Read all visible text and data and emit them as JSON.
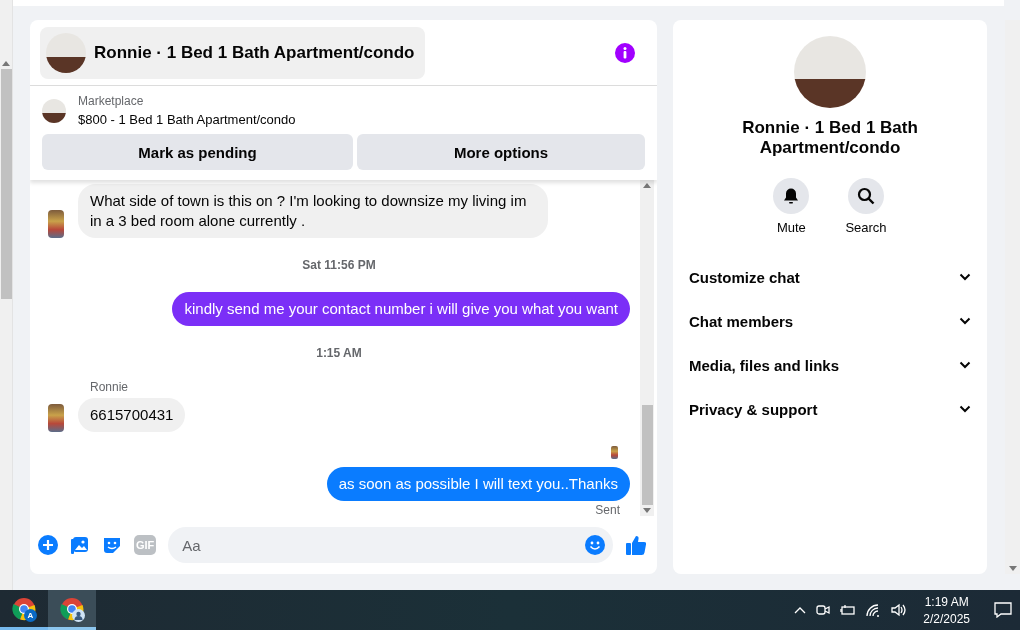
{
  "chat": {
    "title": "Ronnie · 1 Bed 1 Bath Apartment/condo",
    "listing": {
      "label": "Marketplace",
      "title": "$800 - 1 Bed 1 Bath Apartment/condo"
    },
    "actions": [
      "Mark as pending",
      "More options"
    ],
    "messages": [
      {
        "kind": "incoming",
        "text": "What side of town is this on ? I'm looking to downsize my living im in a 3 bed room alone currently ."
      },
      {
        "kind": "timestamp",
        "text": "Sat 11:56 PM"
      },
      {
        "kind": "outgoing",
        "text": "kindly send me your contact number i will give you what you want",
        "color": "#7b2ff7",
        "seen": false
      },
      {
        "kind": "timestamp",
        "text": "1:15 AM"
      },
      {
        "kind": "incoming",
        "sender": "Ronnie",
        "text": "6615700431"
      },
      {
        "kind": "outgoing",
        "text": "as soon as possible I will text you..Thanks",
        "color": "#0a7cff",
        "seen": true,
        "status": "Sent"
      }
    ],
    "composer": {
      "placeholder": "Aa",
      "gif_label": "GIF"
    }
  },
  "details": {
    "title": "Ronnie · 1 Bed 1 Bath Apartment/condo",
    "quick_actions": [
      {
        "kind": "mute",
        "label": "Mute"
      },
      {
        "kind": "search",
        "label": "Search"
      }
    ],
    "sections": [
      {
        "label": "Customize chat",
        "expanded": false
      },
      {
        "label": "Chat members",
        "expanded": false
      },
      {
        "label": "Media, files and links",
        "expanded": false
      },
      {
        "label": "Privacy & support",
        "expanded": false
      }
    ]
  },
  "taskbar": {
    "apps": [
      {
        "kind": "letter",
        "badge": "A",
        "selected": false
      },
      {
        "kind": "person",
        "selected": true
      }
    ],
    "time": "1:19 AM",
    "date": "2/2/2025"
  }
}
